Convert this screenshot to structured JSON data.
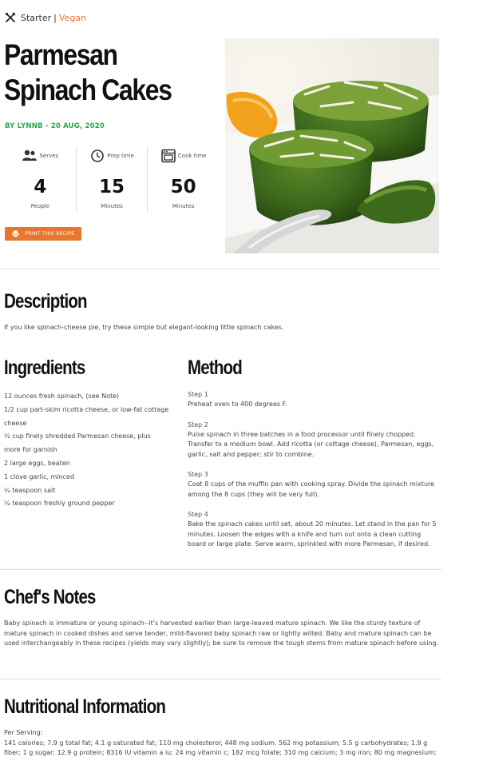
{
  "breadcrumb": {
    "category": "Starter",
    "separator": "|",
    "diet": "Vegan",
    "icon": "utensils-icon"
  },
  "recipe": {
    "title": "Parmesan Spinach Cakes",
    "byline": "BY LYNNB - 20 AUG, 2020",
    "stats": [
      {
        "label": "Serves",
        "value": "4",
        "unit": "People",
        "icon": "people-icon"
      },
      {
        "label": "Prep time",
        "value": "15",
        "unit": "Minutes",
        "icon": "clock-icon"
      },
      {
        "label": "Cook time",
        "value": "50",
        "unit": "Minutes",
        "icon": "oven-icon"
      }
    ],
    "print_label": "PRINT THIS RECIPE"
  },
  "colors": {
    "accent": "#e8772e",
    "byline": "#2ea44f"
  },
  "description": {
    "heading": "Description",
    "text": "If you like spinach-cheese pie, try these simple but elegant-looking little spinach cakes."
  },
  "ingredients": {
    "heading": "Ingredients",
    "items": [
      "12 ounces fresh spinach, (see Note)",
      "1/2 cup part-skim ricotta cheese, or low-fat cottage",
      "cheese",
      "½ cup finely shredded Parmesan cheese, plus",
      "more for garnish",
      "2 large eggs, beaten",
      "1 clove garlic, minced",
      "¼ teaspoon salt",
      "¼ teaspoon freshly ground pepper"
    ]
  },
  "method": {
    "heading": "Method",
    "steps": [
      {
        "label": "Step 1",
        "text": "Preheat oven to 400 degrees F."
      },
      {
        "label": "Step 2",
        "text": "Pulse spinach in three batches in a food processor until finely chopped. Transfer to a medium bowl. Add ricotta (or cottage cheese), Parmesan, eggs, garlic, salt and pepper; stir to combine."
      },
      {
        "label": "Step 3",
        "text": "Coat 8 cups of the muffin pan with cooking spray. Divide the spinach mixture among the 8 cups (they will be very full)."
      },
      {
        "label": "Step 4",
        "text": "Bake the spinach cakes until set, about 20 minutes. Let stand in the pan for 5 minutes. Loosen the edges with a knife and turn out onto a clean cutting board or large plate. Serve warm, sprinkled with more Parmesan, if desired."
      }
    ]
  },
  "notes": {
    "heading": "Chef's Notes",
    "text": "Baby spinach is immature or young spinach--it's harvested earlier than large-leaved mature spinach. We like the sturdy texture of mature spinach in cooked dishes and serve tender, mild-flavored baby spinach raw or lightly wilted. Baby and mature spinach can be used interchangeably in these recipes (yields may vary slightly); be sure to remove the tough stems from mature spinach before using."
  },
  "nutrition": {
    "heading": "Nutritional Information",
    "serving_label": "Per Serving:",
    "text": "141 calories; 7.9 g total fat; 4.1 g saturated fat; 110 mg cholesterol; 448 mg sodium. 562 mg potassium; 5.5 g carbohydrates; 1.9 g fiber; 1 g sugar; 12.9 g protein; 8316 IU vitamin a iu; 24 mg vitamin c; 182 mcg folate; 310 mg calcium; 3 mg iron; 80 mg magnesium;"
  }
}
